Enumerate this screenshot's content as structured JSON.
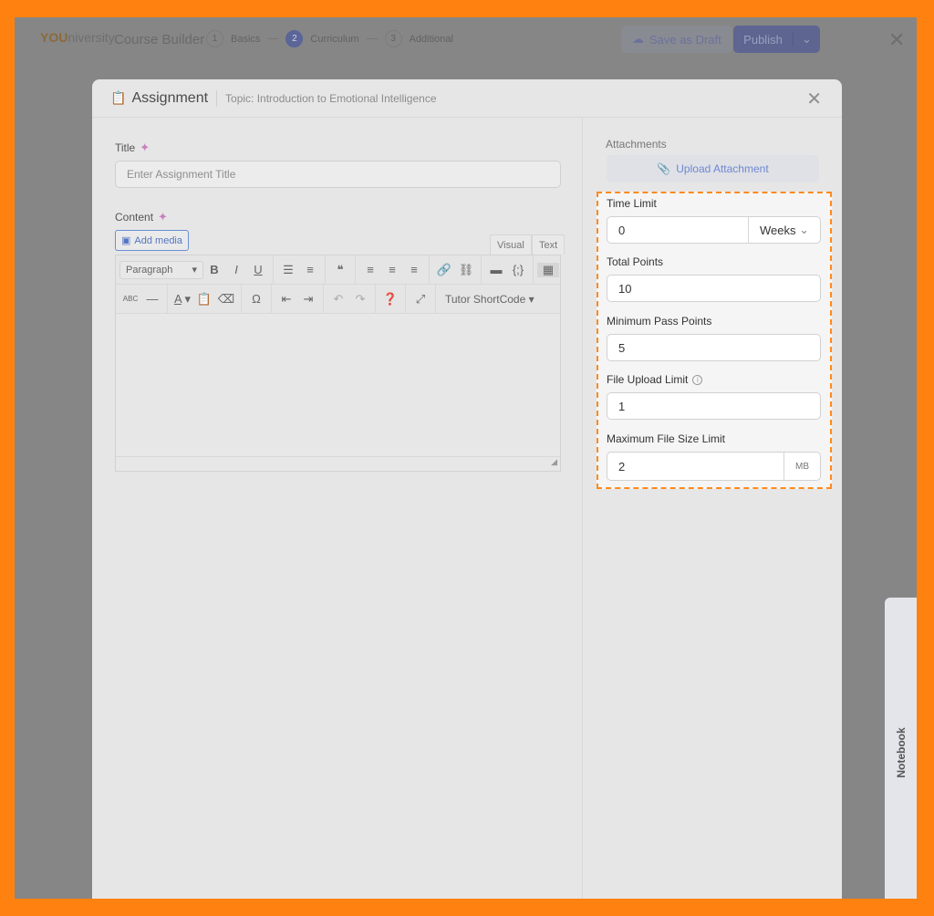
{
  "topbar": {
    "logo_brand": "YOU",
    "logo_rest": "niversity",
    "title": "Course Builder",
    "steps": [
      {
        "num": "1",
        "label": "Basics"
      },
      {
        "num": "2",
        "label": "Curriculum",
        "active": true
      },
      {
        "num": "3",
        "label": "Additional"
      }
    ],
    "save_draft": "Save as Draft",
    "publish": "Publish"
  },
  "modal": {
    "title": "Assignment",
    "topic": "Topic: Introduction to Emotional Intelligence",
    "title_label": "Title",
    "title_placeholder": "Enter Assignment Title",
    "content_label": "Content",
    "add_media": "Add media",
    "tab_visual": "Visual",
    "tab_text": "Text",
    "format_select": "Paragraph",
    "shortcode": "Tutor ShortCode",
    "attachments_label": "Attachments",
    "upload_attachment": "Upload Attachment",
    "time_limit": {
      "label": "Time Limit",
      "value": "0",
      "unit": "Weeks"
    },
    "total_points": {
      "label": "Total Points",
      "value": "10"
    },
    "min_pass": {
      "label": "Minimum Pass Points",
      "value": "5"
    },
    "file_upload_limit": {
      "label": "File Upload Limit",
      "value": "1"
    },
    "max_file_size": {
      "label": "Maximum File Size Limit",
      "value": "2",
      "unit": "MB"
    }
  },
  "notebook": "Notebook",
  "colors": {
    "highlight": "#ff8a1e",
    "primary": "#5a6598"
  }
}
